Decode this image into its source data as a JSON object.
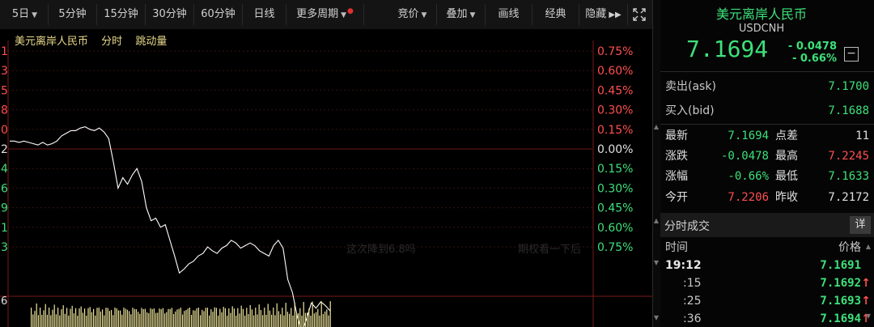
{
  "toolbar": {
    "periods": [
      "5日",
      "5分钟",
      "15分钟",
      "30分钟",
      "60分钟",
      "日线",
      "更多周期"
    ],
    "right_buttons": [
      "竞价",
      "叠加",
      "画线",
      "经典",
      "隐藏"
    ]
  },
  "chart": {
    "title_items": [
      "美元离岸人民币",
      "分时",
      "跳动量"
    ],
    "left_ticks": [
      "1",
      "3",
      "5",
      "8",
      "0",
      "2",
      "4",
      "6",
      "9",
      "1",
      "3"
    ],
    "right_ticks": [
      "0.75%",
      "0.60%",
      "0.45%",
      "0.30%",
      "0.15%",
      "0.00%",
      "0.15%",
      "0.30%",
      "0.45%",
      "0.60%",
      "0.75%"
    ],
    "volume_tick": "6",
    "watermark": [
      "这次降到6.8吗",
      "期权看一下后"
    ],
    "colors": {
      "line": "#ffffff",
      "up": "#ff4f4f",
      "down": "#3de07a",
      "volume": "#f0e59a",
      "grid": "#3a1010"
    }
  },
  "chart_data": {
    "type": "line",
    "title": "美元离岸人民币 分时 跳动量",
    "y_right_ticks": [
      "0.75%",
      "0.60%",
      "0.45%",
      "0.30%",
      "0.15%",
      "0.00%",
      "0.15%",
      "0.30%",
      "0.45%",
      "0.60%",
      "0.75%"
    ],
    "ylim_pct": [
      -0.75,
      0.75
    ],
    "series": [
      {
        "values": [
          0.06,
          0.06,
          0.05,
          0.06,
          0.05,
          0.04,
          0.03,
          0.05,
          0.03,
          0.04,
          0.06,
          0.1,
          0.12,
          0.14,
          0.14,
          0.16,
          0.17,
          0.15,
          0.14,
          0.16,
          0.13,
          0.08,
          -0.1,
          -0.3,
          -0.22,
          -0.27,
          -0.2,
          -0.15,
          -0.25,
          -0.45,
          -0.55,
          -0.53,
          -0.6,
          -0.58,
          -0.7,
          -0.82,
          -0.95,
          -0.92,
          -0.88,
          -0.86,
          -0.82,
          -0.8,
          -0.75,
          -0.78,
          -0.8,
          -0.76,
          -0.74,
          -0.7,
          -0.72,
          -0.76,
          -0.74,
          -0.72,
          -0.74,
          -0.78,
          -0.8,
          -0.82,
          -0.74,
          -0.7,
          -0.76,
          -1.0,
          -1.1,
          -1.28,
          -1.4,
          -1.3,
          -1.18,
          -1.22,
          -1.17,
          -1.2,
          -1.24
        ]
      }
    ]
  },
  "quote": {
    "name": "美元离岸人民币",
    "code": "USDCNH",
    "price": "7.1694",
    "change": "- 0.0478",
    "change_pct": "- 0.66%",
    "collapse_icon": "minus-square-icon"
  },
  "order_book": [
    {
      "label": "卖出(ask)",
      "value": "7.1700"
    },
    {
      "label": "买入(bid)",
      "value": "7.1688"
    }
  ],
  "stats": [
    {
      "l1": "最新",
      "v1": "7.1694",
      "c1": "g",
      "l2": "点差",
      "v2": "11",
      "c2": "w"
    },
    {
      "l1": "涨跌",
      "v1": "-0.0478",
      "c1": "g",
      "l2": "最高",
      "v2": "7.2245",
      "c2": "r"
    },
    {
      "l1": "涨幅",
      "v1": "-0.66%",
      "c1": "g",
      "l2": "最低",
      "v2": "7.1633",
      "c2": "g"
    },
    {
      "l1": "今开",
      "v1": "7.2206",
      "c1": "r",
      "l2": "昨收",
      "v2": "7.2172",
      "c2": "w"
    }
  ],
  "ticks": {
    "title": "分时成交",
    "detail_label": "详",
    "col_time": "时间",
    "col_price": "价格",
    "rows": [
      {
        "time": "19:12",
        "price": "7.1691",
        "arrow": ""
      },
      {
        "time": ":15",
        "price": "7.1692",
        "arrow": "↑"
      },
      {
        "time": ":25",
        "price": "7.1693",
        "arrow": "↑"
      },
      {
        "time": ":36",
        "price": "7.1694",
        "arrow": "↑"
      }
    ]
  }
}
